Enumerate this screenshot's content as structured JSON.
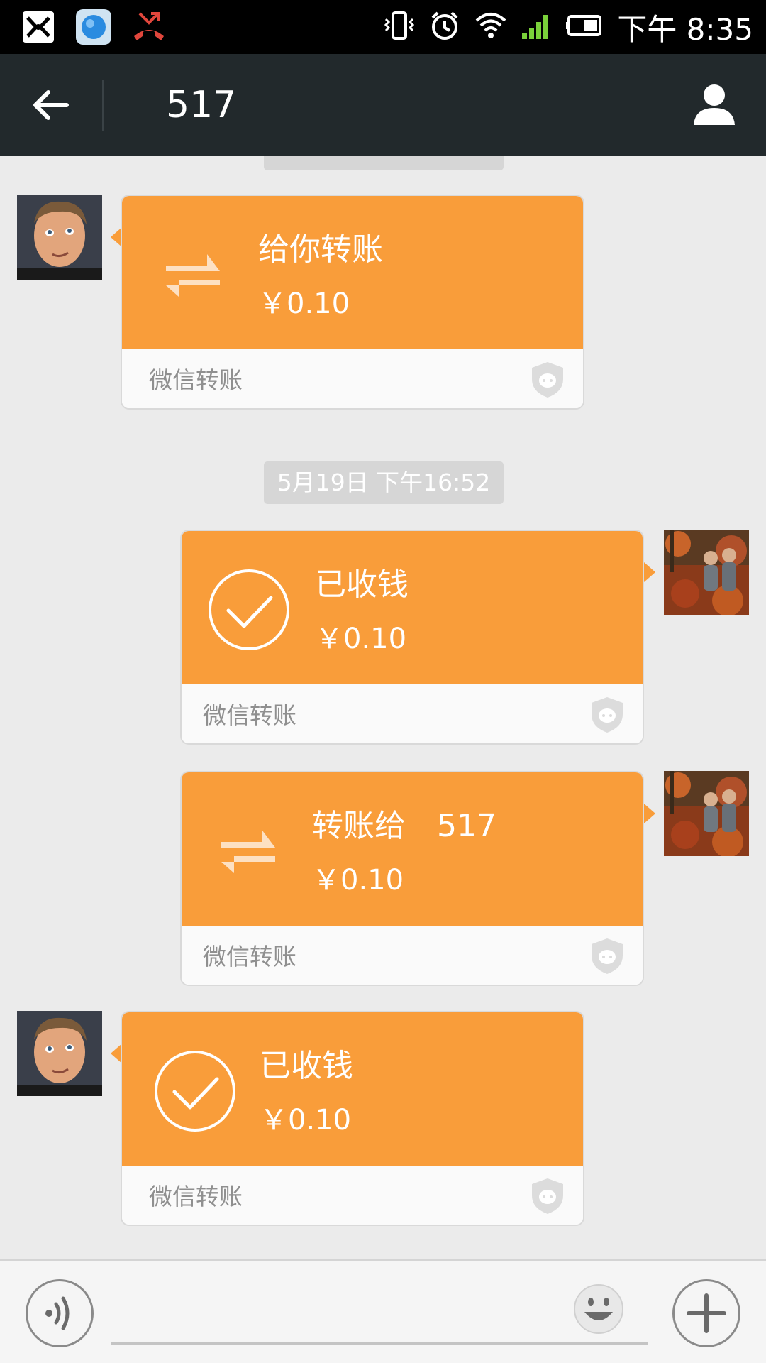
{
  "status_bar": {
    "time": "下午 8:35",
    "icons": [
      "app-icon",
      "browser-icon",
      "missed-call-icon",
      "vibrate-icon",
      "alarm-icon",
      "wifi-icon",
      "signal-icon",
      "battery-icon"
    ]
  },
  "header": {
    "title": "517",
    "back_icon": "arrow-left-icon",
    "profile_icon": "person-icon"
  },
  "chat": {
    "timestamps": [
      "5月19日 下午16:52"
    ],
    "messages": [
      {
        "side": "left",
        "kind": "transfer",
        "title": "给你转账",
        "amount": "￥0.10",
        "brand": "微信转账"
      },
      {
        "side": "right",
        "kind": "received",
        "title": "已收钱",
        "amount": "￥0.10",
        "brand": "微信转账"
      },
      {
        "side": "right",
        "kind": "transfer",
        "title": "转账给",
        "recipient": "517",
        "amount": "￥0.10",
        "brand": "微信转账"
      },
      {
        "side": "left",
        "kind": "received",
        "title": "已收钱",
        "amount": "￥0.10",
        "brand": "微信转账"
      }
    ]
  },
  "input_bar": {
    "voice_icon": "voice-icon",
    "emoji_icon": "smiley-icon",
    "plus_icon": "plus-icon"
  },
  "colors": {
    "accent": "#f99d3a",
    "header_bg": "#22292c",
    "chat_bg": "#ebebeb"
  }
}
